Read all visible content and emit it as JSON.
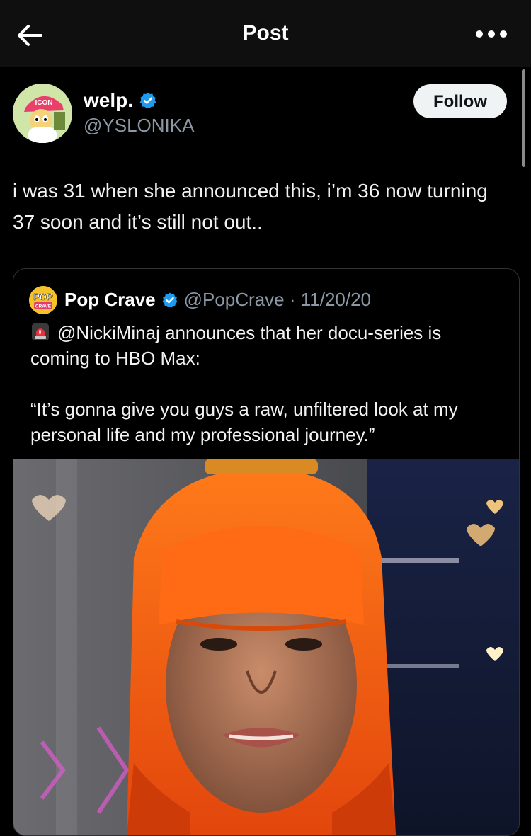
{
  "header": {
    "title": "Post",
    "back_icon": "arrow-left-icon",
    "more_icon": "more-horizontal-icon"
  },
  "author": {
    "display_name": "welp.",
    "handle": "@YSLONIKA",
    "verified": true,
    "avatar_cap_text": "ICON",
    "follow_label": "Follow"
  },
  "post": {
    "text": "i was 31 when she announced this, i’m 36 now turning 37 soon and it’s still not out.."
  },
  "quote": {
    "avatar_text_top": "POP",
    "avatar_text_bottom": "CRAVE",
    "display_name": "Pop Crave",
    "verified": true,
    "meta": "@PopCrave · 11/20/20",
    "line1": "@NickiMinaj announces that her docu-series is coming to HBO Max:",
    "line2": "“It’s gonna give you guys a raw, unfiltered look at my personal life and my professional journey.”",
    "line1_icon": "siren-icon",
    "media": "video-thumbnail"
  },
  "colors": {
    "background": "#000000",
    "topbar": "#0f0f0f",
    "verified_blue": "#1d9bf0",
    "muted_text": "#8b98a5",
    "follow_bg": "#eff3f4"
  }
}
